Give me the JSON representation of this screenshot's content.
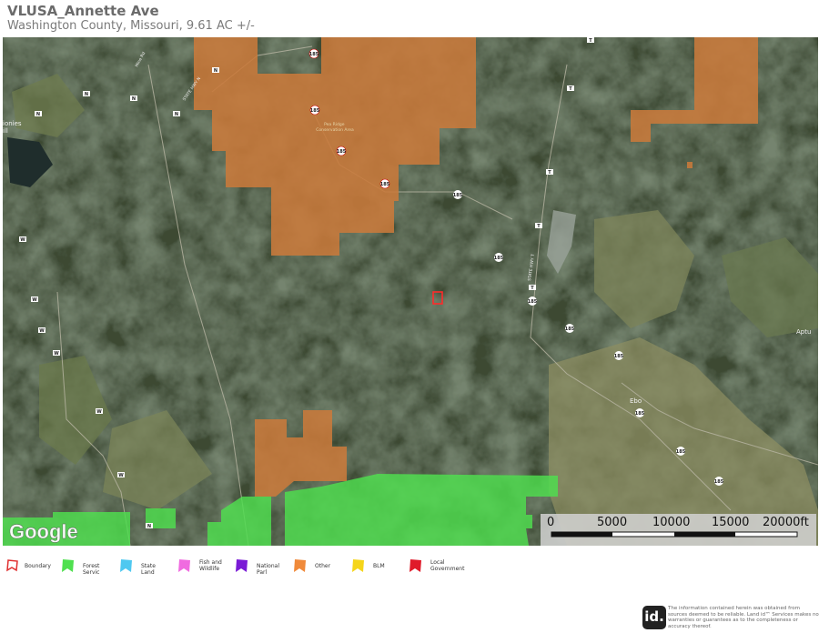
{
  "header": {
    "title": "VLUSA_Annette Ave",
    "subtitle": "Washington County, Missouri, 9.61 AC +/-"
  },
  "map": {
    "attribution": "Google",
    "place_labels": [
      "Pea Ridge Conservation Area",
      "Ebo",
      "Aptu",
      "ionies\nill"
    ],
    "road_labels": [
      "Mine Rd",
      "STATE HWY N",
      "STATE HWY T"
    ],
    "route_shields": [
      "N",
      "N",
      "N",
      "N",
      "N",
      "185",
      "185",
      "185",
      "185",
      "185",
      "185",
      "185",
      "185",
      "185",
      "185",
      "185",
      "185",
      "T",
      "T",
      "T",
      "T",
      "T",
      "W",
      "W",
      "W",
      "W",
      "W",
      "W"
    ],
    "colors": {
      "boundary": "#e11d1d",
      "other": "#c97a3b",
      "forest_service": "#4fe04f"
    }
  },
  "scale": {
    "labels": [
      "0",
      "5000",
      "10000",
      "15000",
      "20000ft"
    ]
  },
  "legend": {
    "items": [
      {
        "label": "Boundary",
        "color": "#e03030",
        "shape": "outline"
      },
      {
        "label": "Forest Servic",
        "color": "#4fe04f",
        "shape": "fill"
      },
      {
        "label": "State Land",
        "color": "#4fc8f0",
        "shape": "fill"
      },
      {
        "label": "Fish and Wildlife",
        "color": "#f06be0",
        "shape": "fill"
      },
      {
        "label": "National Parl",
        "color": "#7a1bd6",
        "shape": "fill"
      },
      {
        "label": "Other",
        "color": "#f08a3a",
        "shape": "fill"
      },
      {
        "label": "BLM",
        "color": "#f5d51a",
        "shape": "fill"
      },
      {
        "label": "Local Government",
        "color": "#e01b2a",
        "shape": "fill"
      }
    ]
  },
  "footer": {
    "logo_text": "id.",
    "disclaimer": "The information contained herein was obtained from sources deemed to be reliable. Land id™ Services makes no warranties or guarantees as to the completeness or accuracy thereof."
  }
}
